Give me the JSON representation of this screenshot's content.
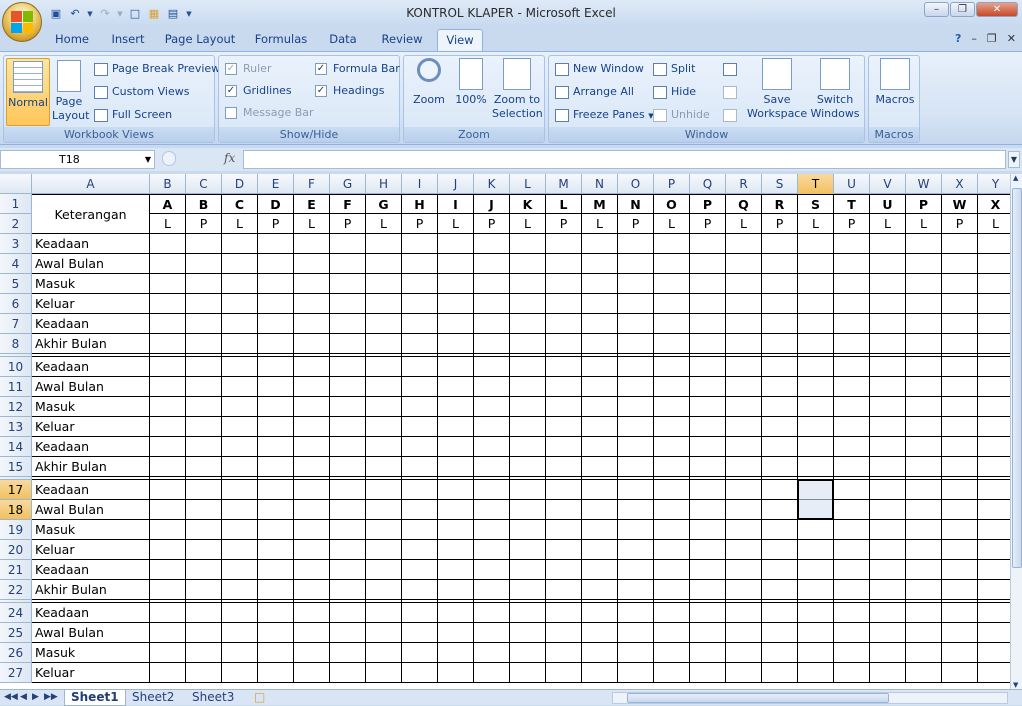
{
  "window": {
    "title": "KONTROL KLAPER - Microsoft Excel"
  },
  "tabs": [
    "Home",
    "Insert",
    "Page Layout",
    "Formulas",
    "Data",
    "Review",
    "View"
  ],
  "active_tab": "View",
  "ribbon": {
    "workbook_views": {
      "label": "Workbook Views",
      "normal": "Normal",
      "page_layout": "Page Layout",
      "page_break_preview": "Page Break Preview",
      "custom_views": "Custom Views",
      "full_screen": "Full Screen"
    },
    "show_hide": {
      "label": "Show/Hide",
      "ruler": "Ruler",
      "gridlines": "Gridlines",
      "message_bar": "Message Bar",
      "formula_bar": "Formula Bar",
      "headings": "Headings"
    },
    "zoom": {
      "label": "Zoom",
      "zoom": "Zoom",
      "hundred": "100%",
      "zoom_to_selection": "Zoom to Selection"
    },
    "window": {
      "label": "Window",
      "new_window": "New Window",
      "arrange_all": "Arrange All",
      "freeze_panes": "Freeze Panes",
      "split": "Split",
      "hide": "Hide",
      "unhide": "Unhide",
      "save_workspace": "Save Workspace",
      "switch_windows": "Switch Windows"
    },
    "macros": {
      "label": "Macros",
      "macros": "Macros"
    }
  },
  "formula_bar": {
    "name_box": "T18",
    "fx": "fx",
    "formula": ""
  },
  "columns": [
    "A",
    "B",
    "C",
    "D",
    "E",
    "F",
    "G",
    "H",
    "I",
    "J",
    "K",
    "L",
    "M",
    "N",
    "O",
    "P",
    "Q",
    "R",
    "S",
    "T",
    "U",
    "V",
    "W",
    "X",
    "Y"
  ],
  "selected_column": "T",
  "header_row1": [
    "A",
    "B",
    "C",
    "D",
    "E",
    "F",
    "G",
    "H",
    "I",
    "J",
    "K",
    "L",
    "M",
    "N",
    "O",
    "P",
    "Q",
    "R",
    "S",
    "T",
    "U",
    "P",
    "W",
    "X"
  ],
  "header_row2": [
    "L",
    "P",
    "L",
    "P",
    "L",
    "P",
    "L",
    "P",
    "L",
    "P",
    "L",
    "P",
    "L",
    "P",
    "L",
    "P",
    "L",
    "P",
    "L",
    "P",
    "L",
    "L",
    "P",
    "L",
    "P"
  ],
  "keterangan": "Keterangan",
  "rows": [
    {
      "n": "1",
      "a": ""
    },
    {
      "n": "2",
      "a": ""
    },
    {
      "n": "3",
      "a": "Keadaan"
    },
    {
      "n": "4",
      "a": "Awal Bulan"
    },
    {
      "n": "5",
      "a": "Masuk"
    },
    {
      "n": "6",
      "a": "Keluar"
    },
    {
      "n": "7",
      "a": "Keadaan"
    },
    {
      "n": "8",
      "a": "Akhir Bulan"
    },
    {
      "n": "9",
      "a": ""
    },
    {
      "n": "10",
      "a": "Keadaan"
    },
    {
      "n": "11",
      "a": "Awal Bulan"
    },
    {
      "n": "12",
      "a": "Masuk"
    },
    {
      "n": "13",
      "a": "Keluar"
    },
    {
      "n": "14",
      "a": "Keadaan"
    },
    {
      "n": "15",
      "a": "Akhir Bulan"
    },
    {
      "n": "16",
      "a": ""
    },
    {
      "n": "17",
      "a": "Keadaan"
    },
    {
      "n": "18",
      "a": "Awal Bulan"
    },
    {
      "n": "19",
      "a": "Masuk"
    },
    {
      "n": "20",
      "a": "Keluar"
    },
    {
      "n": "21",
      "a": "Keadaan"
    },
    {
      "n": "22",
      "a": "Akhir Bulan"
    },
    {
      "n": "23",
      "a": ""
    },
    {
      "n": "24",
      "a": "Keadaan"
    },
    {
      "n": "25",
      "a": "Awal Bulan"
    },
    {
      "n": "26",
      "a": "Masuk"
    },
    {
      "n": "27",
      "a": "Keluar"
    }
  ],
  "selected_rows": [
    "17",
    "18"
  ],
  "sheets": [
    "Sheet1",
    "Sheet2",
    "Sheet3"
  ],
  "active_sheet": "Sheet1"
}
